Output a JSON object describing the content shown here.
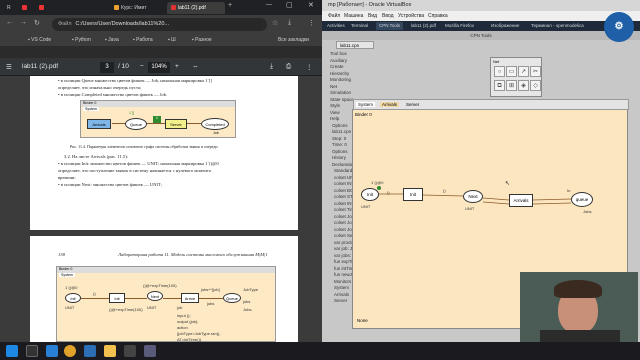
{
  "browser": {
    "tabs": [
      "R",
      "",
      "",
      "Курс: Имит",
      "lab11 (2).pdf"
    ],
    "address": "C:/Users/User/Downloads/lab11%20...",
    "address_prefix": "Файл",
    "bookmarks": [
      "VS Code",
      "Python",
      "Java",
      "Работа",
      "Ш",
      "Разное"
    ],
    "bookmarks_all": "Все закладки",
    "pdf": {
      "filename": "lab11 (2).pdf",
      "page_current": "3",
      "page_total": "/ 10",
      "zoom": "104%"
    },
    "page1": {
      "lines": [
        "• в позиции Queue множество цветов фишек — Job, начальная маркировка 1`[]",
        "  определяет, что изначально очередь пуста;",
        "• в позиции Completed множество цветов фишек — Job."
      ],
      "binder": "Binder 0",
      "system_tab": "System",
      "fig_nodes": [
        "Arrivals",
        "Queue",
        "Server",
        "Completed"
      ],
      "fig_marks": [
        "1`[]",
        "1`[]"
      ],
      "fig_sub": "Job",
      "caption": "Рис. 11.4. Параметры элементов основного графа системы обработки заявок в очереди",
      "section": "3.2. На листе Arrivals (рис. 11.5):",
      "items": [
        "• в позиции Init: множество цветов фишек — UNIT; начальная маркировка 1`()@0",
        "  определяет, что поступление заявок в систему начинается с нулевого момента",
        "  времени;",
        "• в позиции Next: множество цветов фишек — UNIT;"
      ]
    },
    "page2": {
      "header_left": "138",
      "header_center": "Лабораторная работа 11. Модель системы массового обслуживания M|M|1",
      "binder": "Binder 0",
      "system_tab": "System",
      "nodes": [
        "Init",
        "Init",
        "Next",
        "Arrive",
        "Queue"
      ],
      "labels": [
        "1`()@0",
        "UNIT",
        "()",
        "()@+expTime(100)",
        "UNIT",
        "()@+expTime(100)",
        "jobs^^[job]",
        "jobs",
        "job",
        "JobType",
        "jobs",
        "Jobs",
        "input ();",
        "output (job);",
        "action",
        "{jobType=JobType.ran(),",
        "AT=intTime()}"
      ]
    }
  },
  "vbox": {
    "title": "mp [Работает] - Oracle VirtualBox",
    "menu": [
      "Файл",
      "Машина",
      "Вид",
      "Ввод",
      "Устройства",
      "Справка"
    ],
    "guest_tabs": [
      "Activities",
      "Terminal",
      "CPN Tools",
      "lab11 (2).pdf",
      "Mozilla Firefox",
      "Изображение",
      "Терминал - openmodelica"
    ],
    "cpn": {
      "window_title": "CPN Tools",
      "binder_tab": "lab11.cpn",
      "tree": [
        "Tool box",
        "Auxiliary",
        "Create",
        "Hierarchy",
        "Monitoring",
        "Net",
        "Simulation",
        "State space",
        "Style",
        "View",
        "Help",
        "Options",
        "lab11.cpn",
        "Step: 0",
        "Time: 0",
        "Options",
        "History",
        "Declarations",
        "Standard",
        "colset UNIT",
        "colset INT",
        "colset BOOL",
        "colset STRING",
        "colset INTINF",
        "colset Time",
        "colset JobType",
        "colset Job",
        "colset Jobs",
        "colset Server",
        "var proctime",
        "var job: Job",
        "var jobs: Jobs",
        "fun expTime",
        "fun intTime",
        "fun newJob",
        "Monitors",
        "System",
        "Arrivals",
        "Server"
      ],
      "palette_title": "Net",
      "canvas_tabs": [
        "System",
        "Arrivals",
        "Server"
      ],
      "binder": "Binder 0",
      "net": {
        "nodes": [
          "Init",
          "Init",
          "Next",
          "Arrivals",
          "queue"
        ],
        "labels": [
          "1`()@0",
          "UNIT",
          "UNIT",
          "()",
          "()",
          "Jobs",
          "In"
        ],
        "foot": "None"
      }
    }
  },
  "taskbar": {
    "icons": [
      "start",
      "search",
      "vscode",
      "chrome",
      "virtualbox",
      "explorer",
      "terminal",
      "store"
    ]
  },
  "colors": {
    "canvas_bg": "#fbe6c0",
    "arc": "#8b5a2b",
    "token": "#2e8b2e",
    "fig_arrivals": "#7fb6e8",
    "fig_server": "#f2f08a"
  }
}
